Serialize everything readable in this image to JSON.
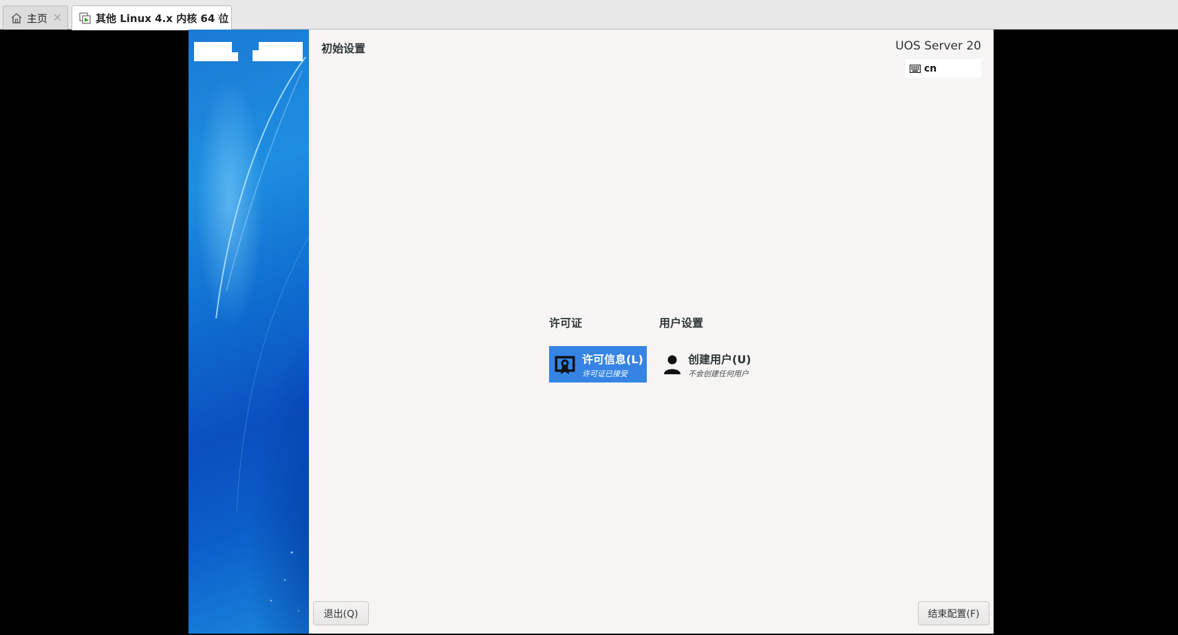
{
  "tabs": [
    {
      "label": "主页",
      "icon": "home-icon",
      "close": "✕"
    },
    {
      "label": "其他 Linux 4.x 内核 64 位",
      "icon": "vm-running-icon",
      "close": "✕"
    }
  ],
  "installer": {
    "page_title": "初始设置",
    "product": "UOS Server 20",
    "keyboard_layout": "cn",
    "sections": [
      {
        "title": "许可证",
        "spoke": {
          "title": "许可信息(L)",
          "status": "许可证已接受",
          "icon": "license-certificate-icon",
          "selected": true
        }
      },
      {
        "title": "用户设置",
        "spoke": {
          "title": "创建用户(U)",
          "status": "不会创建任何用户",
          "icon": "user-icon",
          "selected": false
        }
      }
    ],
    "quit_button": "退出(Q)",
    "finish_button": "结束配置(F)"
  },
  "colors": {
    "selected_spoke": "#3584e4",
    "panel_bg": "#f6f5f4",
    "banner_blue": "#0f6ed0"
  }
}
